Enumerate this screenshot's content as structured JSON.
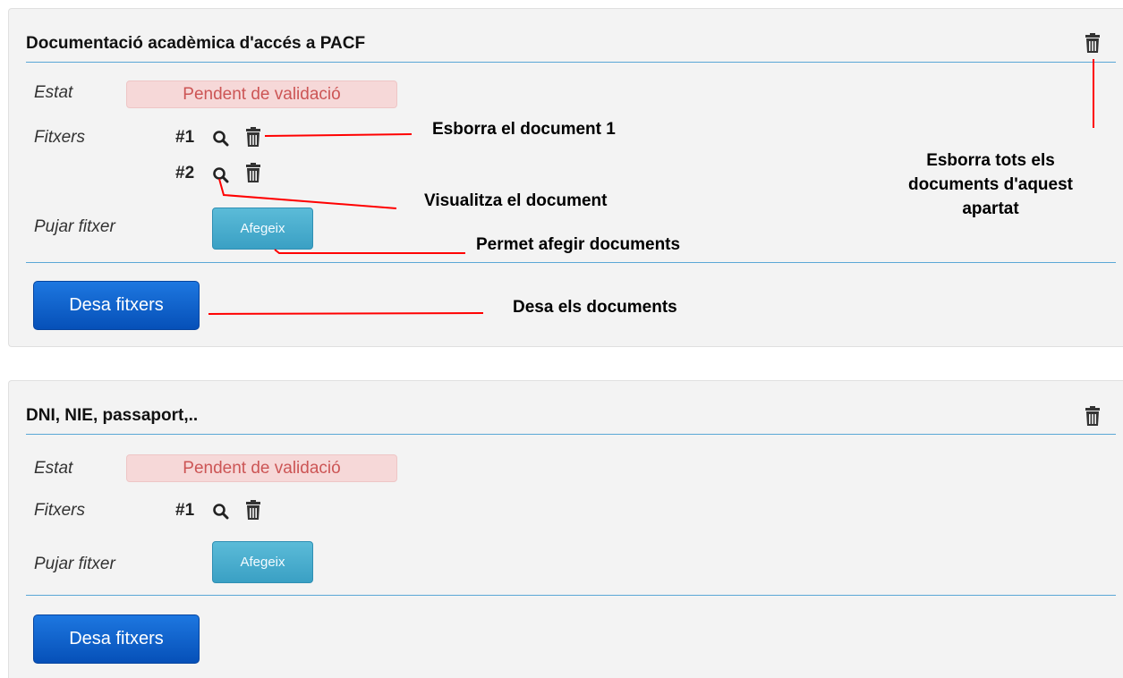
{
  "sections": [
    {
      "title": "Documentació acadèmica d'accés a PACF",
      "status_label": "Estat",
      "status_value": "Pendent de validació",
      "files_label": "Fitxers",
      "files": [
        "#1",
        "#2"
      ],
      "upload_label": "Pujar fitxer",
      "add_button": "Afegeix",
      "save_button": "Desa fitxers"
    },
    {
      "title": "DNI, NIE, passaport,..",
      "status_label": "Estat",
      "status_value": "Pendent de validació",
      "files_label": "Fitxers",
      "files": [
        "#1"
      ],
      "upload_label": "Pujar fitxer",
      "add_button": "Afegeix",
      "save_button": "Desa fitxers"
    }
  ],
  "annotations": {
    "delete_document_1": "Esborra el document 1",
    "view_document": "Visualitza el document",
    "add_documents": "Permet afegir documents",
    "save_documents": "Desa els documents",
    "delete_all_line1": "Esborra tots els",
    "delete_all_line2": "documents d'aquest",
    "delete_all_line3": "apartat"
  },
  "colors": {
    "accent_line": "#5aa7d6",
    "badge_bg": "#f6d8d8",
    "badge_text": "#cc5555",
    "info_button": "#3aa0c4",
    "primary_button": "#0650b8",
    "annotation_line": "#ff0000"
  },
  "icons": [
    "trash-icon",
    "search-icon"
  ]
}
